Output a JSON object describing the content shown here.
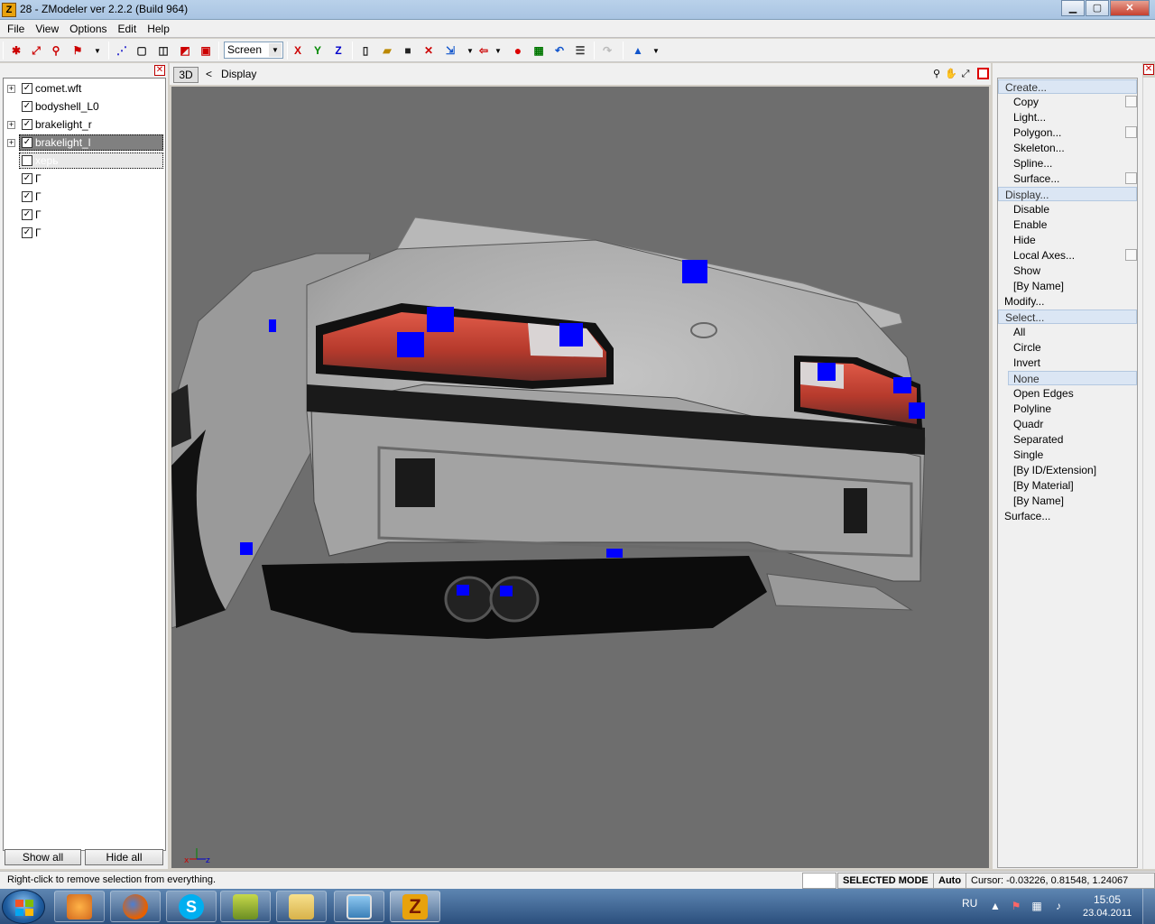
{
  "window": {
    "title": "28 - ZModeler ver 2.2.2 (Build 964)",
    "app_icon_letter": "Z",
    "minimize": "▁",
    "maximize": "▢",
    "close": "✕"
  },
  "menubar": {
    "items": [
      "File",
      "View",
      "Options",
      "Edit",
      "Help"
    ]
  },
  "toolbar": {
    "coord_mode": "Screen",
    "axis_x": "X",
    "axis_y": "Y",
    "axis_z": "Z"
  },
  "left_panel": {
    "tree": [
      {
        "label": "comet.wft",
        "checked": true,
        "expandable": true
      },
      {
        "label": "bodyshell_L0",
        "checked": true,
        "expandable": false
      },
      {
        "label": "brakelight_r",
        "checked": true,
        "expandable": true
      },
      {
        "label": "brakelight_l",
        "checked": true,
        "expandable": true,
        "selected": true
      },
      {
        "label": "херь",
        "checked": false,
        "expandable": false,
        "dim": true
      },
      {
        "label": "Г",
        "checked": true,
        "expandable": false
      },
      {
        "label": "Г",
        "checked": true,
        "expandable": false
      },
      {
        "label": "Г",
        "checked": true,
        "expandable": false
      },
      {
        "label": "Г",
        "checked": true,
        "expandable": false
      }
    ],
    "show_all": "Show all",
    "hide_all": "Hide all"
  },
  "viewport": {
    "mode": "3D",
    "breadcrumb_sep": "<",
    "label": "Display",
    "axis_x": "x",
    "axis_z": "z"
  },
  "right_panel": {
    "items": [
      {
        "text": "Create...",
        "kind": "section-hl"
      },
      {
        "text": "Copy",
        "kind": "sub",
        "check": true
      },
      {
        "text": "Light...",
        "kind": "sub"
      },
      {
        "text": "Polygon...",
        "kind": "sub",
        "check": true
      },
      {
        "text": "Skeleton...",
        "kind": "sub"
      },
      {
        "text": "Spline...",
        "kind": "sub"
      },
      {
        "text": "Surface...",
        "kind": "sub",
        "check": true
      },
      {
        "text": "Display...",
        "kind": "section-hl"
      },
      {
        "text": "Disable",
        "kind": "sub"
      },
      {
        "text": "Enable",
        "kind": "sub"
      },
      {
        "text": "Hide",
        "kind": "sub"
      },
      {
        "text": "Local Axes...",
        "kind": "sub",
        "check": true
      },
      {
        "text": "Show",
        "kind": "sub"
      },
      {
        "text": "[By Name]",
        "kind": "sub"
      },
      {
        "text": "Modify...",
        "kind": "section"
      },
      {
        "text": "Select...",
        "kind": "section-hl"
      },
      {
        "text": "All",
        "kind": "sub"
      },
      {
        "text": "Circle",
        "kind": "sub"
      },
      {
        "text": "Invert",
        "kind": "sub"
      },
      {
        "text": "None",
        "kind": "sub-hl"
      },
      {
        "text": "Open Edges",
        "kind": "sub"
      },
      {
        "text": "Polyline",
        "kind": "sub"
      },
      {
        "text": "Quadr",
        "kind": "sub"
      },
      {
        "text": "Separated",
        "kind": "sub"
      },
      {
        "text": "Single",
        "kind": "sub"
      },
      {
        "text": "[By ID/Extension]",
        "kind": "sub"
      },
      {
        "text": "[By Material]",
        "kind": "sub"
      },
      {
        "text": "[By Name]",
        "kind": "sub"
      },
      {
        "text": "Surface...",
        "kind": "section"
      }
    ]
  },
  "statusbar": {
    "hint": "Right-click to remove selection from everything.",
    "mode": "SELECTED MODE",
    "auto": "Auto",
    "cursor": "Cursor: -0.03226, 0.81548, 1.24067"
  },
  "taskbar": {
    "apps": [
      "media-player",
      "firefox",
      "skype",
      "app-green",
      "explorer",
      "image-viewer",
      "zmodeler"
    ],
    "lang": "RU",
    "time": "15:05",
    "date": "23.04.2011"
  },
  "colors": {
    "viewport_bg": "#6e6e6e",
    "vertex_marker": "#0000ff",
    "taillight": "#c0392b"
  }
}
